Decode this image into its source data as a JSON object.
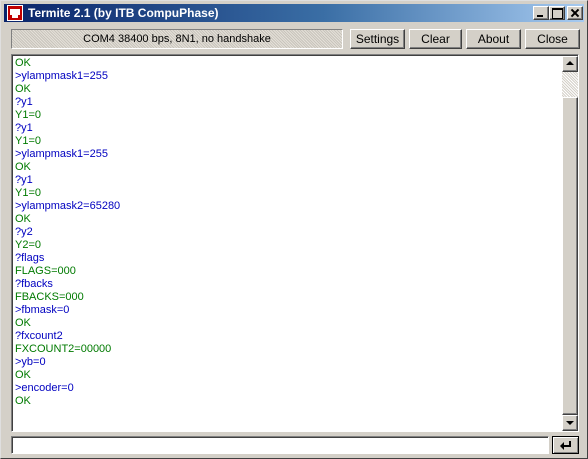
{
  "window": {
    "title": "Termite 2.1 (by ITB CompuPhase)"
  },
  "toolbar": {
    "status": "COM4 38400 bps, 8N1, no handshake",
    "settings_label": "Settings",
    "clear_label": "Clear",
    "about_label": "About",
    "close_label": "Close"
  },
  "colors": {
    "sent_text": "#0000c0",
    "received_text": "#007a00",
    "titlebar_start": "#0a246a",
    "face": "#d4d0c8"
  },
  "terminal": {
    "lines": [
      {
        "text": "OK",
        "dir": "in"
      },
      {
        "text": ">ylampmask1=255",
        "dir": "out"
      },
      {
        "text": "OK",
        "dir": "in"
      },
      {
        "text": "?y1",
        "dir": "out"
      },
      {
        "text": "Y1=0",
        "dir": "in"
      },
      {
        "text": "?y1",
        "dir": "out"
      },
      {
        "text": "Y1=0",
        "dir": "in"
      },
      {
        "text": ">ylampmask1=255",
        "dir": "out"
      },
      {
        "text": "OK",
        "dir": "in"
      },
      {
        "text": "?y1",
        "dir": "out"
      },
      {
        "text": "Y1=0",
        "dir": "in"
      },
      {
        "text": ">ylampmask2=65280",
        "dir": "out"
      },
      {
        "text": "OK",
        "dir": "in"
      },
      {
        "text": "?y2",
        "dir": "out"
      },
      {
        "text": "Y2=0",
        "dir": "in"
      },
      {
        "text": "?flags",
        "dir": "out"
      },
      {
        "text": "FLAGS=000",
        "dir": "in"
      },
      {
        "text": "?fbacks",
        "dir": "out"
      },
      {
        "text": "FBACKS=000",
        "dir": "in"
      },
      {
        "text": ">fbmask=0",
        "dir": "out"
      },
      {
        "text": "OK",
        "dir": "in"
      },
      {
        "text": "?fxcount2",
        "dir": "out"
      },
      {
        "text": "FXCOUNT2=00000",
        "dir": "in"
      },
      {
        "text": ">yb=0",
        "dir": "out"
      },
      {
        "text": "OK",
        "dir": "in"
      },
      {
        "text": ">encoder=0",
        "dir": "out"
      },
      {
        "text": "OK",
        "dir": "in"
      }
    ]
  },
  "input": {
    "value": "",
    "send_icon": "enter-arrow-icon"
  }
}
